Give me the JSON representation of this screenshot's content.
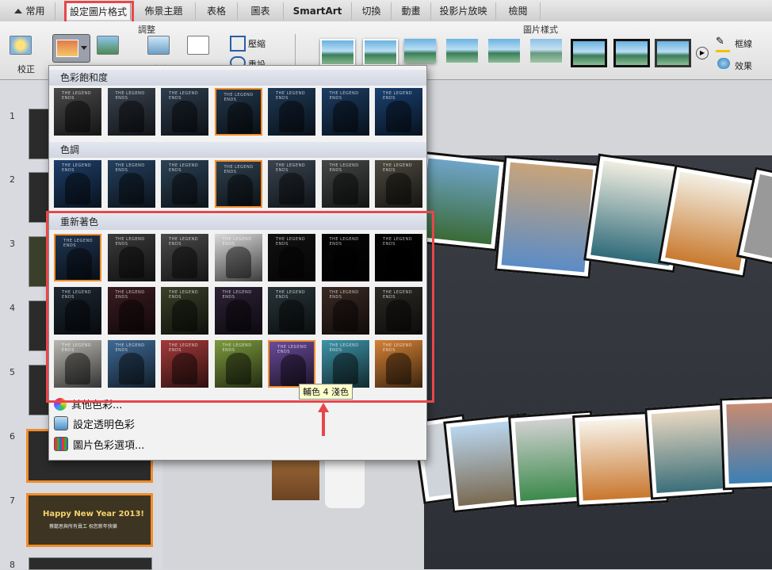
{
  "tabs": [
    {
      "label": "常用",
      "active": false
    },
    {
      "label": "設定圖片格式",
      "active": true
    },
    {
      "label": "佈景主題",
      "active": false
    },
    {
      "label": "表格",
      "active": false
    },
    {
      "label": "圖表",
      "active": false
    },
    {
      "label": "SmartArt",
      "active": false
    },
    {
      "label": "切換",
      "active": false
    },
    {
      "label": "動畫",
      "active": false
    },
    {
      "label": "投影片放映",
      "active": false
    },
    {
      "label": "檢閱",
      "active": false
    }
  ],
  "ribbon": {
    "group_adjust": "調整",
    "group_styles": "圖片樣式",
    "correct_label": "校正",
    "remove_label": "移除",
    "compress_label": "壓縮",
    "reset_label": "重設",
    "border_label": "框線",
    "effect_label": "效果"
  },
  "menu": {
    "sections": [
      {
        "title": "色彩飽和度"
      },
      {
        "title": "色調"
      },
      {
        "title": "重新著色"
      }
    ],
    "items": [
      {
        "label": "其他色彩..."
      },
      {
        "label": "設定透明色彩"
      },
      {
        "label": "圖片色彩選項..."
      }
    ],
    "swatch_caption": "THE LEGEND ENDS",
    "tooltip": "輔色 4 淺色",
    "colors": {
      "saturation": [
        "#4a4a4a",
        "#3b4450",
        "#2e3d4e",
        "#24384d",
        "#1f3a57",
        "#1d3d63",
        "#1a4170"
      ],
      "tone": [
        "#1f3f6a",
        "#25405f",
        "#2c4256",
        "#2f4150",
        "#3a4450",
        "#444746",
        "#4d4a40"
      ],
      "recolor_row1": [
        "#1f3552",
        "#3a3a3a",
        "#4a4a4a",
        "#d8d8d8",
        "#111111",
        "#050505",
        "#020202"
      ],
      "recolor_row2": [
        "#1d2733",
        "#3a1c22",
        "#39402a",
        "#2d2236",
        "#283438",
        "#3b2a24",
        "#2c2a25"
      ],
      "recolor_row3": [
        "#b9b8b2",
        "#3f6a95",
        "#a53a3a",
        "#7d9a3e",
        "#6a4a9a",
        "#3e94a8",
        "#d58236"
      ]
    }
  },
  "slides": {
    "numbers": [
      "1",
      "2",
      "3",
      "4",
      "5",
      "6",
      "7",
      "8"
    ],
    "slide7_title": "Happy New Year 2013!",
    "slide7_sub": "蔡懿思與所有員工 祝您新年快樂"
  }
}
